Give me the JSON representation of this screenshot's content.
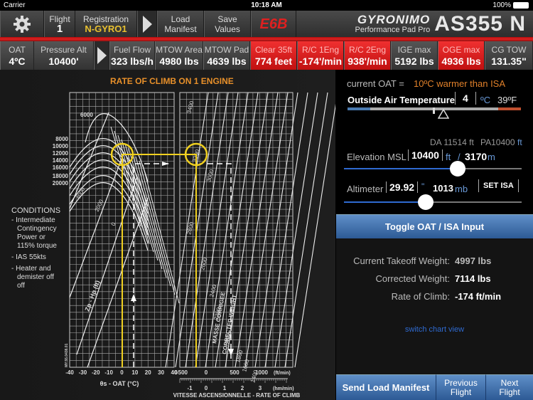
{
  "status_bar": {
    "carrier": "Carrier",
    "time": "10:18 AM",
    "battery": "100%"
  },
  "topbar": {
    "flight_label": "Flight",
    "flight_value": "1",
    "registration_label": "Registration",
    "registration_value": "N-GYRO1",
    "load_manifest": [
      "Load",
      "Manifest"
    ],
    "save_values": [
      "Save",
      "Values"
    ],
    "logo_badge": "E6B",
    "brand_name": "GYRONIMO",
    "brand_sub": "Performance Pad Pro",
    "model": "AS355 N"
  },
  "infobar": [
    {
      "label": "OAT",
      "value": "4ºC",
      "highlight": false
    },
    {
      "label": "Pressure Alt",
      "value": "10400'",
      "highlight": false
    },
    {
      "label": "Fuel Flow",
      "value": "323 lbs/h",
      "highlight": false
    },
    {
      "label": "MTOW Area",
      "value": "4980 lbs",
      "highlight": false
    },
    {
      "label": "MTOW Pad",
      "value": "4639 lbs",
      "highlight": false
    },
    {
      "label": "Clear 35ft",
      "value": "774 feet",
      "highlight": true
    },
    {
      "label": "R/C 1Eng",
      "value": "-174'/min",
      "highlight": true
    },
    {
      "label": "R/C 2Eng",
      "value": "938'/min",
      "highlight": true
    },
    {
      "label": "IGE max",
      "value": "5192 lbs",
      "highlight": false
    },
    {
      "label": "OGE max",
      "value": "4936 lbs",
      "highlight": true
    },
    {
      "label": "CG TOW",
      "value": "131.35\"",
      "highlight": false
    }
  ],
  "chart": {
    "title": "RATE OF CLIMB ON 1 ENGINE",
    "conditions_title": "CONDITIONS",
    "conditions": [
      "- Intermediate",
      "Contingency",
      "Power or",
      "115% torque",
      "- IAS 55kts",
      "- Heater and",
      "demister off",
      "off"
    ],
    "altitude_labels": [
      "6000",
      "8000",
      "10000",
      "12000",
      "14000",
      "16000",
      "18000",
      "20000"
    ],
    "hp_labels": [
      "4000",
      "2000",
      "0"
    ],
    "hp_axis": "Zp - Hp (ft)",
    "oat_ticks": [
      "-40",
      "-30",
      "-20",
      "-10",
      "0",
      "10",
      "20",
      "30",
      "40"
    ],
    "oat_axis": "θs - OAT (°C)",
    "doc_ref": "MY.55.0438.01",
    "weight_labels": [
      "3400",
      "3200",
      "3000",
      "2800",
      "2600",
      "2400",
      "2200",
      "2000",
      "1800",
      "1600",
      "1400"
    ],
    "weight_axis_1": "MASSE CORRIGEE",
    "weight_axis_2": "CORRECTED WEIGHT",
    "roc_ticks_ft": [
      "-500",
      "0",
      "500",
      "1000"
    ],
    "roc_unit_ft": "(ft/min)",
    "roc_ticks_hm": [
      "-1",
      "0",
      "1",
      "2",
      "3"
    ],
    "roc_unit_hm": "(hm/min)",
    "roc_axis": "VITESSE ASCENSIONNELLE - RATE OF CLIMB",
    "left_zero": "0"
  },
  "panel": {
    "oat_status_label": "current OAT =",
    "oat_status_value": "10ºC warmer than ISA",
    "oat_title": "Outside Air Temperature",
    "oat_value": "4",
    "oat_unit": "ºC",
    "oat_f": "39ºF",
    "da_text": "DA 11514 ft",
    "pa_text": "PA10400",
    "pa_unit": "ft",
    "elevation_label": "Elevation MSL",
    "elevation_value": "10400",
    "elevation_unit": "ft",
    "elevation_sep": "/",
    "elevation_m": "3170",
    "elevation_m_unit": "m",
    "elevation_slider_fraction": 0.64,
    "altimeter_label": "Altimeter",
    "altimeter_value": "29.92",
    "altimeter_unit": "\"",
    "altimeter_mb": "1013",
    "altimeter_mb_unit": "mb",
    "altimeter_slider_fraction": 0.46,
    "set_isa": "SET ISA",
    "toggle_button": "Toggle OAT / ISA Input",
    "results": [
      {
        "label": "Current Takeoff Weight:",
        "value": "4997 lbs"
      },
      {
        "label": "Corrected Weight:",
        "value": "7114 lbs"
      },
      {
        "label": "Rate of Climb:",
        "value": "-174 ft/min"
      }
    ],
    "switch_view": "switch chart view"
  },
  "bottom": {
    "send": "Send Load Manifest",
    "previous": [
      "Previous",
      "Flight"
    ],
    "next": [
      "Next",
      "Flight"
    ]
  }
}
